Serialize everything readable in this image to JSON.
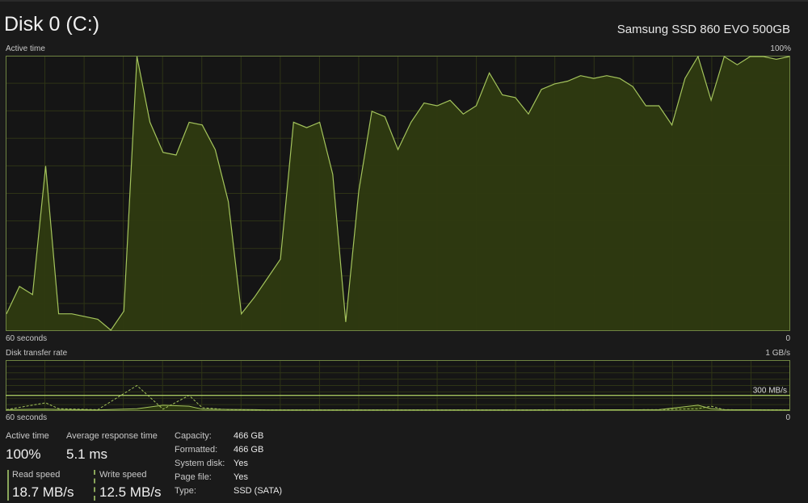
{
  "header": {
    "title": "Disk 0 (C:)",
    "model": "Samsung SSD 860 EVO 500GB"
  },
  "active_chart": {
    "label": "Active time",
    "max_label": "100%",
    "left_axis_label": "60 seconds",
    "right_axis_label": "0"
  },
  "transfer_chart": {
    "label": "Disk transfer rate",
    "max_label": "1 GB/s",
    "line_label": "300 MB/s",
    "left_axis_label": "60 seconds",
    "right_axis_label": "0"
  },
  "colors": {
    "line": "#a4c45c",
    "fill": "#2e3a10",
    "grid": "#2e3416",
    "border": "#6f8442"
  },
  "chart_data": [
    {
      "type": "area",
      "title": "Active time",
      "xlabel": "60 seconds",
      "ylabel": "",
      "x": [
        60,
        59,
        58,
        57,
        56,
        55,
        54,
        53,
        52,
        51,
        50,
        49,
        48,
        47,
        46,
        45,
        44,
        43,
        42,
        41,
        40,
        39,
        38,
        37,
        36,
        35,
        34,
        33,
        32,
        31,
        30,
        29,
        28,
        27,
        26,
        25,
        24,
        23,
        22,
        21,
        20,
        19,
        18,
        17,
        16,
        15,
        14,
        13,
        12,
        11,
        10,
        9,
        8,
        7,
        6,
        5,
        4,
        3,
        2,
        1,
        0
      ],
      "ylim": [
        0,
        100
      ],
      "grid": true,
      "series": [
        {
          "values": [
            6,
            16,
            13,
            60,
            6,
            6,
            5,
            4,
            0,
            7,
            100,
            76,
            65,
            64,
            76,
            75,
            66,
            47,
            6,
            12,
            19,
            26,
            76,
            74,
            76,
            57,
            3,
            51,
            80,
            78,
            66,
            76,
            83,
            82,
            84,
            79,
            82,
            94,
            86,
            85,
            79,
            88,
            90,
            91,
            93,
            92,
            93,
            92,
            89,
            82,
            82,
            75,
            92,
            100,
            84,
            100,
            97,
            100,
            100,
            99,
            100
          ]
        }
      ]
    },
    {
      "type": "line",
      "title": "Disk transfer rate",
      "xlabel": "60 seconds",
      "ylabel": "",
      "x": [
        60,
        57,
        56,
        53,
        50,
        48,
        46,
        45,
        43,
        41,
        40,
        38,
        35,
        20,
        10,
        7,
        6,
        5,
        0
      ],
      "ylim": [
        0,
        1000
      ],
      "grid": true,
      "reference_line": 300,
      "series": [
        {
          "name": "Read speed",
          "values": [
            10,
            20,
            15,
            5,
            30,
            100,
            80,
            20,
            15,
            10,
            5,
            5,
            5,
            5,
            10,
            100,
            30,
            10,
            5
          ]
        },
        {
          "name": "Write speed",
          "values": [
            10,
            150,
            30,
            10,
            500,
            20,
            300,
            50,
            10,
            5,
            5,
            5,
            5,
            5,
            10,
            30,
            80,
            10,
            5
          ]
        }
      ]
    }
  ],
  "stats": {
    "active_time": {
      "label": "Active time",
      "value": "100%"
    },
    "avg_response": {
      "label": "Average response time",
      "value": "5.1 ms"
    },
    "read_speed": {
      "label": "Read speed",
      "value": "18.7 MB/s"
    },
    "write_speed": {
      "label": "Write speed",
      "value": "12.5 MB/s"
    }
  },
  "details": [
    {
      "label": "Capacity:",
      "value": "466 GB"
    },
    {
      "label": "Formatted:",
      "value": "466 GB"
    },
    {
      "label": "System disk:",
      "value": "Yes"
    },
    {
      "label": "Page file:",
      "value": "Yes"
    },
    {
      "label": "Type:",
      "value": "SSD (SATA)"
    }
  ]
}
